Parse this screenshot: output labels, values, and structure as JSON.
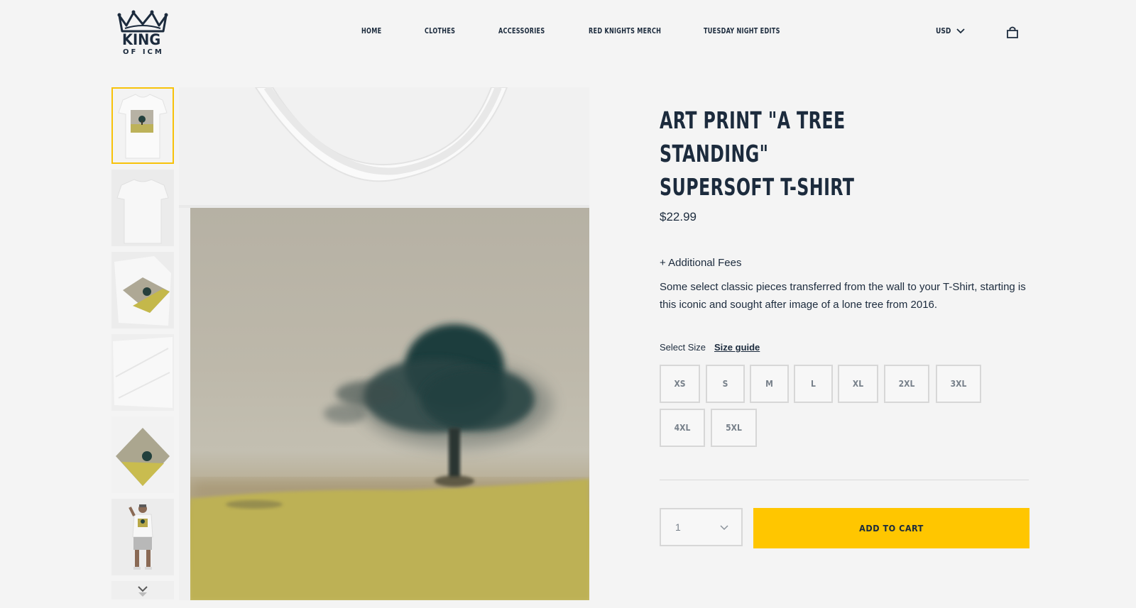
{
  "logo": {
    "line1": "KING",
    "line2": "OF ICM"
  },
  "nav": {
    "items": [
      {
        "label": "HOME"
      },
      {
        "label": "CLOTHES"
      },
      {
        "label": "ACCESSORIES"
      },
      {
        "label": "RED KNIGHTS MERCH"
      },
      {
        "label": "TUESDAY NIGHT EDITS"
      }
    ],
    "currency": "USD",
    "currency_icon": "chevron-down-icon",
    "cart_icon": "shopping-bag-icon"
  },
  "gallery": {
    "thumbnail_count": 7,
    "active_thumbnail": 0,
    "active_border_color": "#f7c20a"
  },
  "product": {
    "title_line1": "ART PRINT \"A TREE STANDING\"",
    "title_line2": "SUPERSOFT T-SHIRT",
    "price": "$22.99",
    "fees": "+ Additional Fees",
    "description": "Some select classic pieces transferred from the wall to your T-Shirt, starting is this iconic and sought after image of a lone tree from 2016.",
    "select_size_label": "Select Size",
    "size_guide_label": "Size guide",
    "sizes": [
      "XS",
      "S",
      "M",
      "L",
      "XL",
      "2XL",
      "3XL",
      "4XL",
      "5XL"
    ],
    "quantity": "1",
    "add_to_cart_label": "ADD TO CART",
    "accent_color": "#ffc600"
  }
}
